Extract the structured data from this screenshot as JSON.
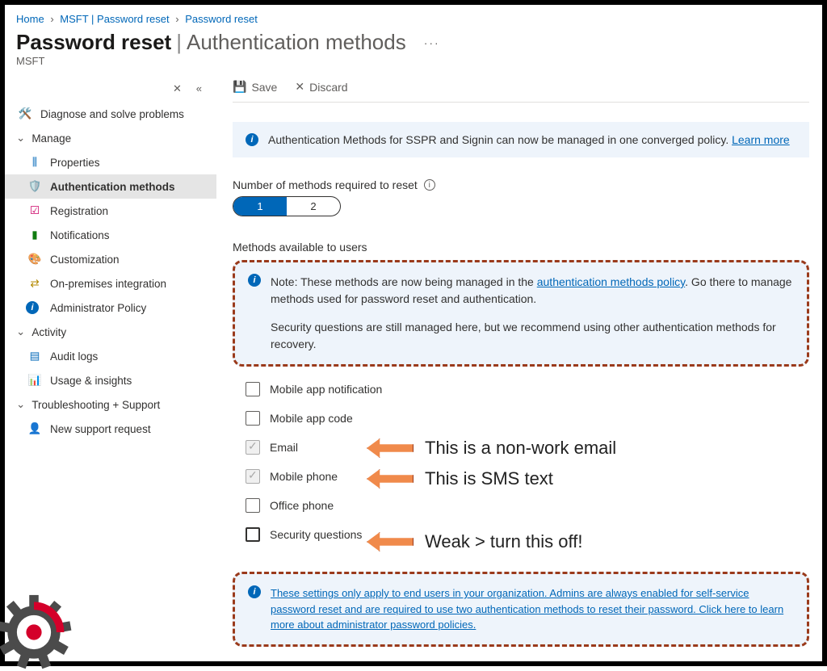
{
  "breadcrumb": {
    "home": "Home",
    "level1": "MSFT | Password reset",
    "level2": "Password reset"
  },
  "header": {
    "title": "Password reset",
    "subtitle": "Authentication methods",
    "org": "MSFT"
  },
  "toolbar": {
    "save": "Save",
    "discard": "Discard"
  },
  "sidebar": {
    "diagnose": "Diagnose and solve problems",
    "groups": {
      "manage": "Manage",
      "activity": "Activity",
      "troubleshoot": "Troubleshooting + Support"
    },
    "items": {
      "properties": "Properties",
      "auth_methods": "Authentication methods",
      "registration": "Registration",
      "notifications": "Notifications",
      "customization": "Customization",
      "onprem": "On-premises integration",
      "adminpolicy": "Administrator Policy",
      "auditlogs": "Audit logs",
      "usage": "Usage & insights",
      "support": "New support request"
    }
  },
  "banner1": {
    "text": "Authentication Methods for SSPR and Signin can now be managed in one converged policy.",
    "link": "Learn more"
  },
  "fields": {
    "num_methods_label": "Number of methods required to reset",
    "seg1": "1",
    "seg2": "2",
    "methods_label": "Methods available to users"
  },
  "note_box": {
    "p1a": "Note: These methods are now being managed in the ",
    "p1link": "authentication methods policy",
    "p1b": ". Go there to manage methods used for password reset and authentication.",
    "p2": "Security questions are still managed here, but we recommend using other authentication methods for recovery."
  },
  "methods": {
    "m1": "Mobile app notification",
    "m2": "Mobile app code",
    "m3": "Email",
    "m4": "Mobile phone",
    "m5": "Office phone",
    "m6": "Security questions"
  },
  "annotations": {
    "a1": "This is a non-work email",
    "a2": "This is SMS text",
    "a3": "Weak > turn this off!"
  },
  "bottom": {
    "text": "These settings only apply to end users in your organization. Admins are always enabled for self-service password reset and are required to use two authentication methods to reset their password. Click here to learn more about administrator password policies."
  }
}
